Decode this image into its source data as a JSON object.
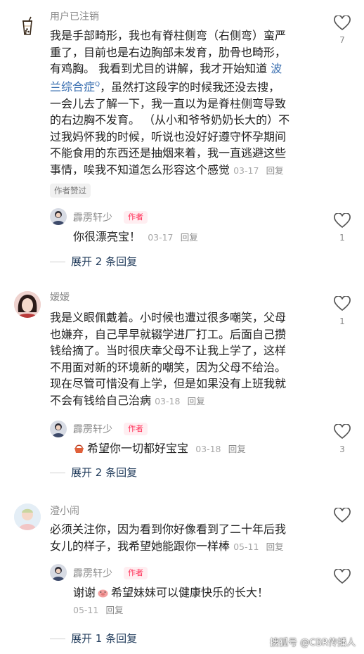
{
  "comments": [
    {
      "user": "用户已注销",
      "text_lines": [
        "我是手部畸形，我也有脊柱侧弯（右侧弯）蛮严",
        "重了，目前也是右边胸部未发育，肋骨也畸形，",
        "有鸡胸。 我看到尤目的讲解，我才开始知道 ",
        "一会儿去了解一下，我一直以为是脊柱侧弯导致",
        "的右边胸不发育。 （从小和爷爷奶奶长大的）不",
        "过我妈怀我的时候，听说也没好好遵守怀孕期间",
        "不能食用的东西还是抽烟来着，我一直逃避这些",
        "事情，唉我不知道怎么形容这个感觉"
      ],
      "link": "波",
      "link_line2": "兰综合症",
      "line4_rest": "，虽然打这段字的时候我还没去搜，",
      "date": "03-17",
      "reply": "回复",
      "liked_tag": "作者赞过",
      "likes": "7",
      "reply_item": {
        "user": "霹雳轩少",
        "badge": "作者",
        "text": "你很漂亮宝！",
        "date": "03-17",
        "reply": "回复",
        "likes": "1"
      },
      "expand": "展开 2 条回复"
    },
    {
      "user": "嫒嫒",
      "text_lines": [
        "我是义眼佩戴着。小时候也遭过很多嘲笑，父母",
        "也嫌弃，自己早早就辍学进厂打工。后面自己攒",
        "钱给摘了。当时很庆幸父母不让我上学了，这样",
        "不用面对新的环境新的嘲笑，因为父母不给治。",
        "现在尽管可惜没有上学，但是如果没有上班我就",
        "不会有钱给自己治病"
      ],
      "date": "03-18",
      "reply": "回复",
      "likes": "1",
      "reply_item": {
        "user": "霹雳轩少",
        "badge": "作者",
        "text": "希望你一切都好宝宝",
        "date": "03-18",
        "reply": "回复",
        "likes": "3"
      },
      "expand": "展开 2 条回复"
    },
    {
      "user": "澄小闹",
      "text_lines": [
        "必须关注你，因为看到你好像看到了二十年后我",
        "女儿的样子，我希望她能跟你一样棒"
      ],
      "date": "05-11",
      "reply": "回复",
      "likes": "",
      "reply_item": {
        "user": "霹雳轩少",
        "badge": "作者",
        "text_a": "谢谢",
        "text_b": "希望妹妹可以健康快乐的长大！",
        "date": "05-11",
        "reply": "回复",
        "likes": ""
      },
      "expand": "展开 1 条回复"
    }
  ],
  "watermark": "搜狐号 @CBR传播人",
  "colors": {
    "accent_link": "#3a6fb0",
    "author_badge": "#ff2c55",
    "expand": "#1f3a5a"
  }
}
